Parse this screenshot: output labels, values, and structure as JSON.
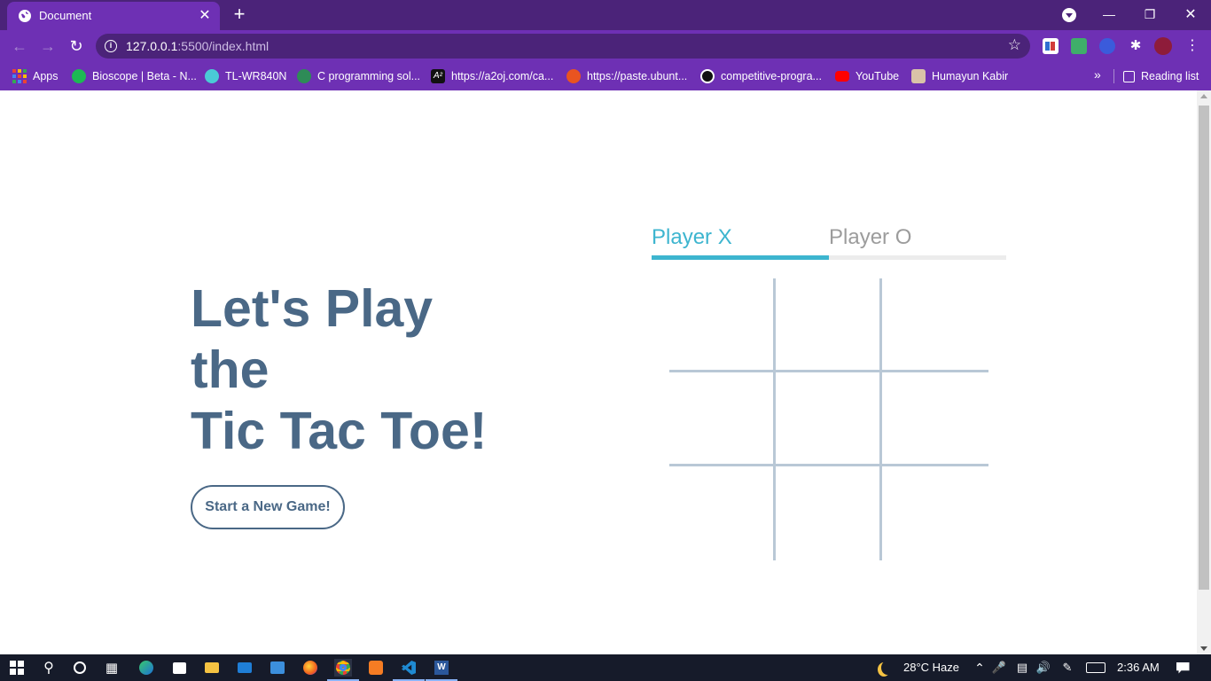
{
  "browser": {
    "tab_title": "Document",
    "url_host": "127.0.0.1",
    "url_path": ":5500/index.html",
    "bookmarks": [
      {
        "label": "Apps",
        "icon": "apps-grid-icon"
      },
      {
        "label": "Bioscope | Beta - N...",
        "icon": "bioscope-icon"
      },
      {
        "label": "TL-WR840N",
        "icon": "tplink-icon"
      },
      {
        "label": "C programming sol...",
        "icon": "c-programming-icon"
      },
      {
        "label": "https://a2oj.com/ca...",
        "icon": "a2oj-icon"
      },
      {
        "label": "https://paste.ubunt...",
        "icon": "ubuntu-icon"
      },
      {
        "label": "competitive-progra...",
        "icon": "github-icon"
      },
      {
        "label": "YouTube",
        "icon": "youtube-icon"
      },
      {
        "label": "Humayun Kabir",
        "icon": "profile-photo-icon"
      }
    ],
    "more_bookmarks": "»",
    "reading_list": "Reading list"
  },
  "game": {
    "headline": [
      "Let's Play",
      "the",
      "Tic Tac Toe!"
    ],
    "start_button": "Start a New Game!",
    "players": {
      "x": "Player X",
      "o": "Player O"
    },
    "active_player": "x",
    "board_cells": [
      "",
      "",
      "",
      "",
      "",
      "",
      "",
      "",
      ""
    ]
  },
  "taskbar": {
    "weather": "28°C  Haze",
    "time": "2:36 AM"
  },
  "colors": {
    "browser_frame": "#4b2379",
    "browser_toolbar": "#6e30b4",
    "headline": "#4a6886",
    "accent": "#3db5cf",
    "grid_lines": "#b9c8d6"
  }
}
